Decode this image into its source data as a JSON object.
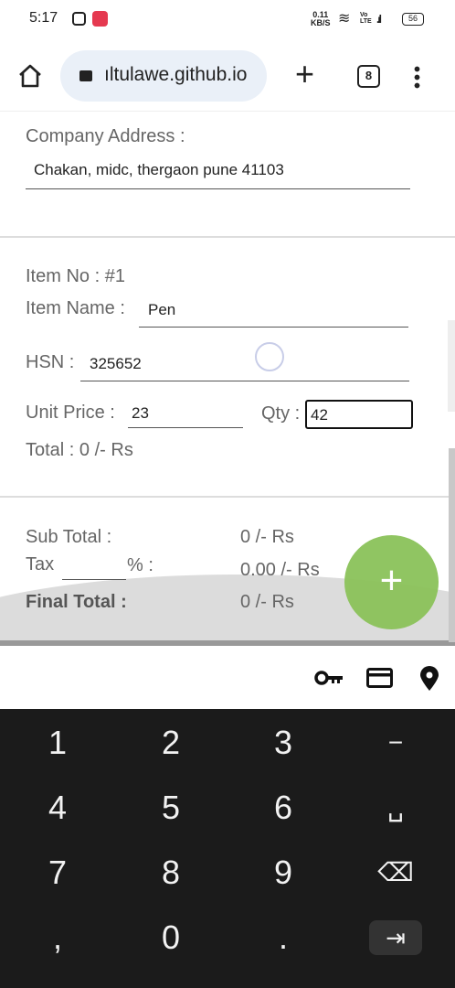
{
  "status": {
    "time": "5:17",
    "net_speed": "0.11",
    "net_unit": "KB/S",
    "volte": "Vo LTE",
    "battery": "56"
  },
  "browser": {
    "url": "ıltulawe.github.io",
    "tab_count": "8"
  },
  "company": {
    "address_label": "Company Address :",
    "address_value": "Chakan, midc, thergaon pune 41103"
  },
  "item": {
    "no_label": "Item No : #1",
    "name_label": "Item Name :",
    "name_value": "Pen",
    "hsn_label": "HSN :",
    "hsn_value": "325652",
    "unit_price_label": "Unit Price :",
    "unit_price_value": "23",
    "qty_label": "Qty :",
    "qty_value": "42",
    "total_label": "Total : 0 /- Rs"
  },
  "summary": {
    "sub_total_label": "Sub Total :",
    "sub_total_value": "0 /- Rs",
    "tax_label": "Tax",
    "tax_pct": "% :",
    "tax_value": "0.00 /- Rs",
    "final_label": "Final Total :",
    "final_value": "0 /- Rs",
    "fab": "+"
  },
  "keyboard": {
    "keys": [
      "1",
      "2",
      "3",
      "−",
      "4",
      "5",
      "6",
      "␣",
      "7",
      "8",
      "9",
      "⌫",
      ",",
      "0",
      ".",
      "⇥"
    ]
  },
  "colors": {
    "fab": "#8bc25a",
    "keyboard_bg": "#1b1b1b"
  }
}
